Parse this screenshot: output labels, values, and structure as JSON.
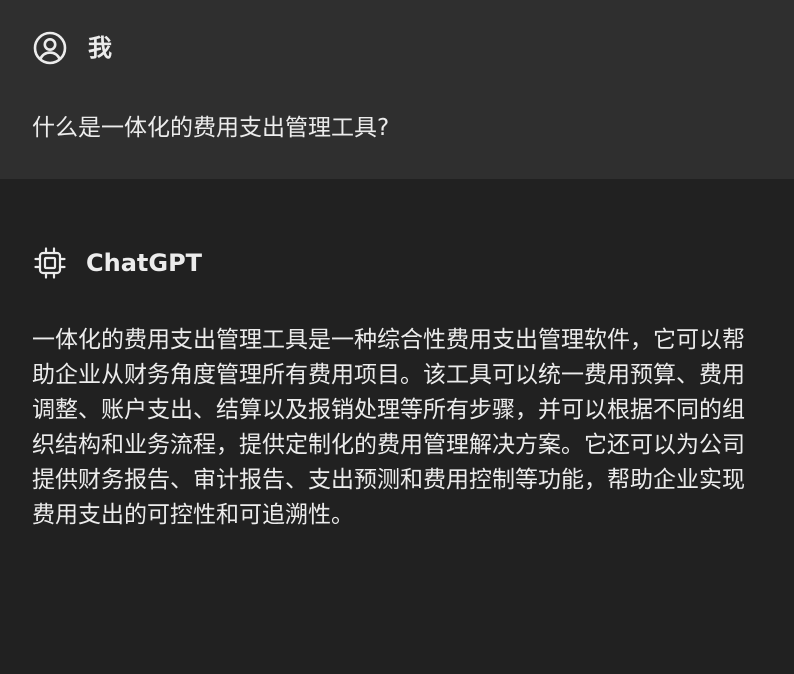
{
  "user_message": {
    "sender": "我",
    "icon": "user-circle-icon",
    "text": "什么是一体化的费用支出管理工具?"
  },
  "assistant_message": {
    "sender": "ChatGPT",
    "icon": "cpu-chip-icon",
    "text": "一体化的费用支出管理工具是一种综合性费用支出管理软件，它可以帮助企业从财务角度管理所有费用项目。该工具可以统一费用预算、费用调整、账户支出、结算以及报销处理等所有步骤，并可以根据不同的组织结构和业务流程，提供定制化的费用管理解决方案。它还可以为公司提供财务报告、审计报告、支出预测和费用控制等功能，帮助企业实现费用支出的可控性和可追溯性。"
  },
  "colors": {
    "user_bg": "#2f2f2f",
    "assistant_bg": "#212121",
    "text": "#ececec"
  }
}
